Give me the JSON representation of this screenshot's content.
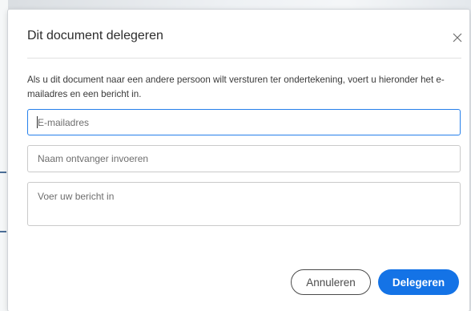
{
  "dialog": {
    "title": "Dit document delegeren",
    "close_icon": "close-icon",
    "description": "Als u dit document naar een andere persoon wilt versturen ter ondertekening, voert u hieronder het e-mailadres en een bericht in.",
    "fields": {
      "email_placeholder": "E-mailadres",
      "email_value": "",
      "name_placeholder": "Naam ontvanger invoeren",
      "name_value": "",
      "message_placeholder": "Voer uw bericht in",
      "message_value": ""
    },
    "buttons": {
      "cancel_label": "Annuleren",
      "delegate_label": "Delegeren"
    }
  },
  "colors": {
    "accent": "#1473e6",
    "focus_border": "#2680eb",
    "text": "#2c2c2c"
  }
}
